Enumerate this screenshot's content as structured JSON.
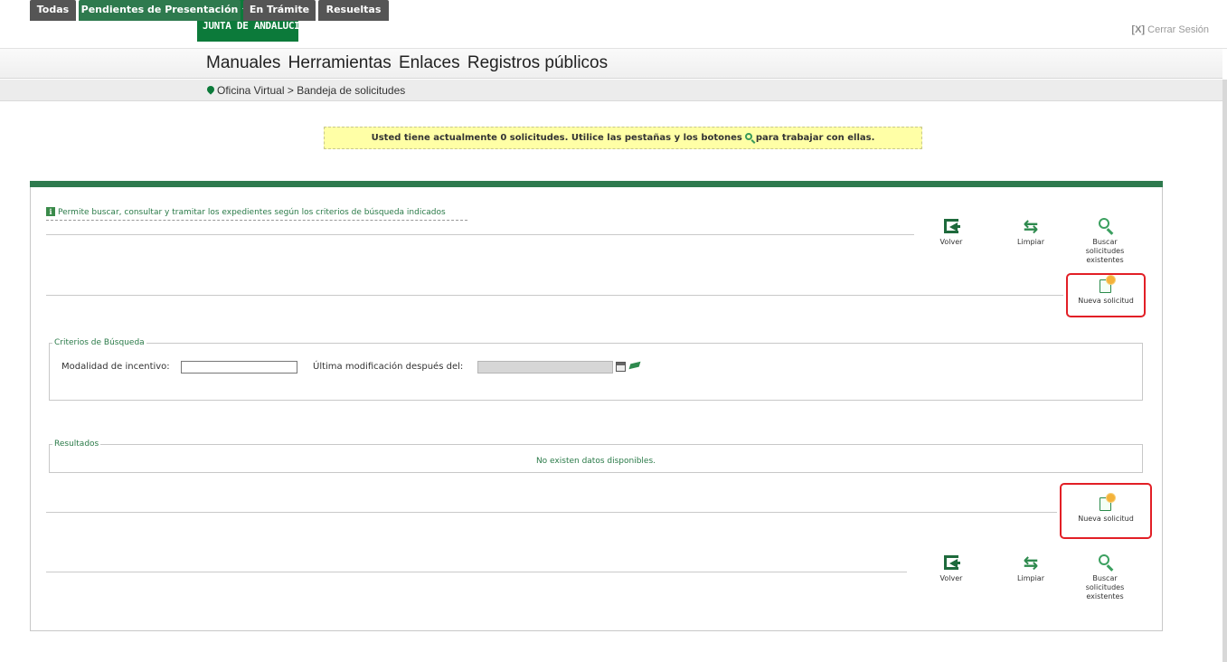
{
  "header": {
    "logo_text": "JUNTA DE ANDALUCIA",
    "logout_bracket": "[X]",
    "logout_label": "Cerrar Sesión"
  },
  "menu": {
    "items": [
      "Manuales",
      "Herramientas",
      "Enlaces",
      "Registros públicos"
    ]
  },
  "breadcrumb": {
    "root": "Oficina Virtual",
    "separator": ">",
    "current": "Bandeja de solicitudes"
  },
  "notice": {
    "text_before": "Usted tiene actualmente 0 solicitudes. Utilice las pestañas y los botones",
    "text_after": "para trabajar con ellas."
  },
  "tabs": [
    {
      "label": "Todas",
      "active": false
    },
    {
      "label": "Pendientes de Presentación",
      "active": true
    },
    {
      "label": "En Trámite",
      "active": false
    },
    {
      "label": "Resueltas",
      "active": false
    }
  ],
  "info": {
    "icon": "i",
    "text": "Permite buscar, consultar y tramitar los expedientes según los criterios de búsqueda indicados"
  },
  "toolbar": {
    "volver": "Volver",
    "limpiar": "Limpiar",
    "buscar_line1": "Buscar",
    "buscar_line2": "solicitudes",
    "buscar_line3": "existentes",
    "nueva": "Nueva solicitud"
  },
  "criteria": {
    "legend": "Criterios de Búsqueda",
    "modalidad_label": "Modalidad de incentivo:",
    "modalidad_value": "",
    "fecha_label": "Última modificación después del:",
    "fecha_value": ""
  },
  "results": {
    "legend": "Resultados",
    "empty_message": "No existen datos disponibles."
  },
  "colors": {
    "brand_green": "#0c7a3a",
    "tab_active": "#2e7a4e",
    "tab_inactive": "#555555",
    "notice_bg": "#ffffa6",
    "highlight_red": "#e21f26"
  }
}
